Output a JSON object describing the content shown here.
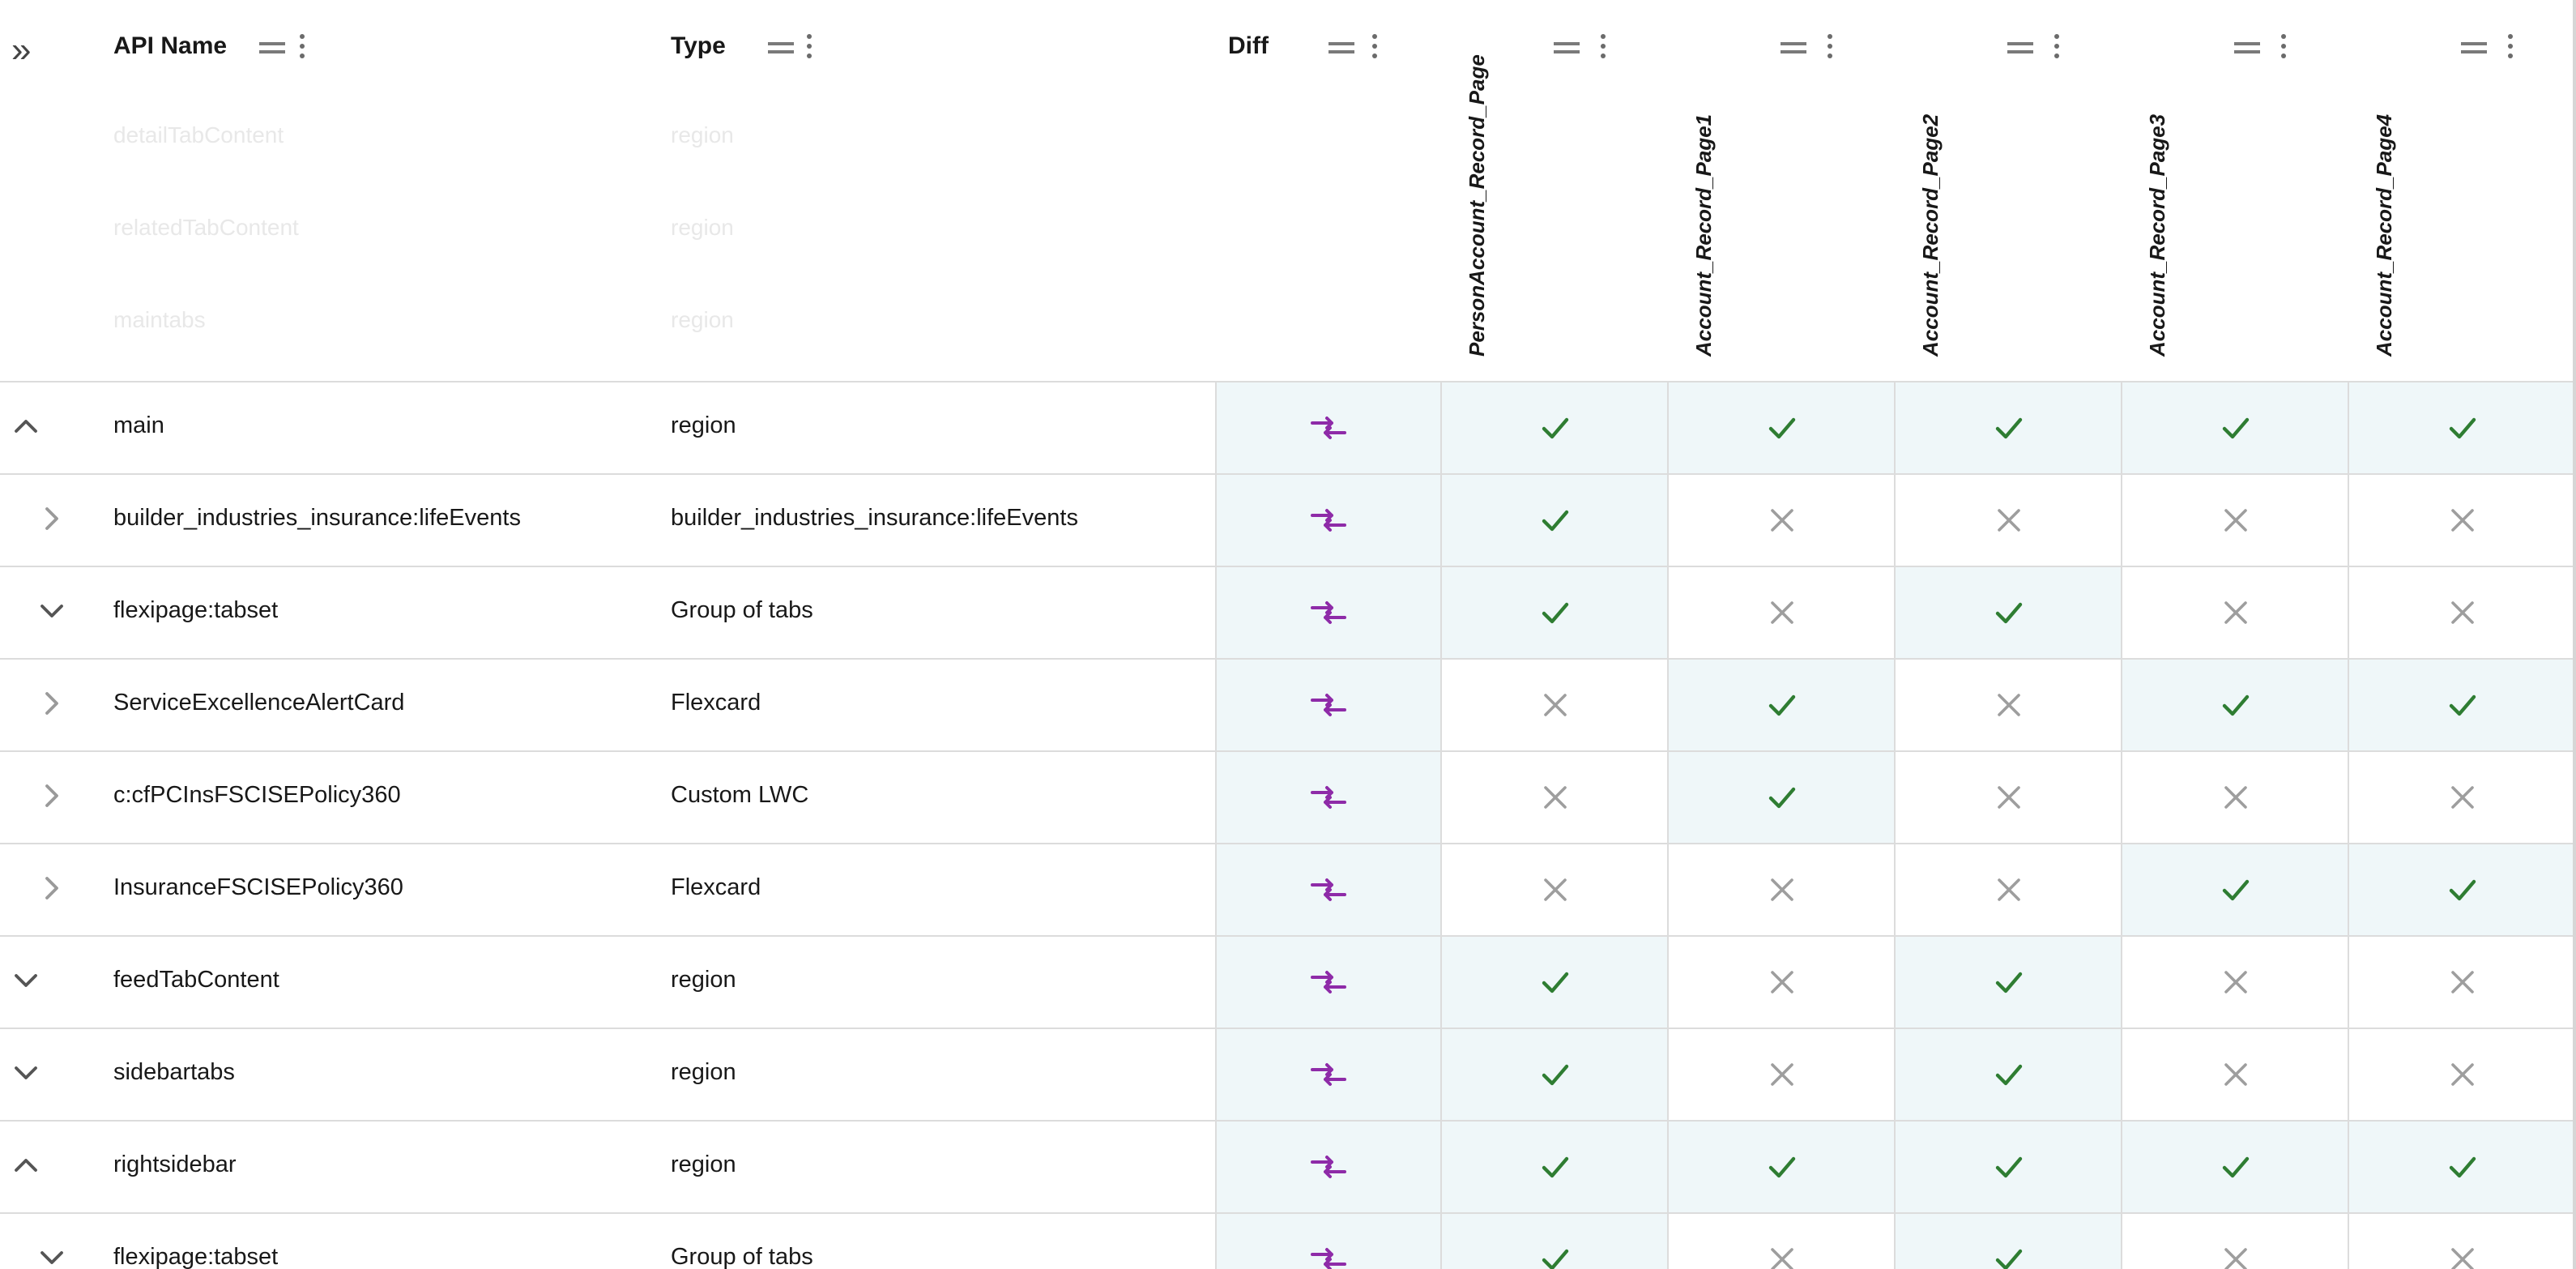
{
  "header": {
    "expand_all_icon": "double-chevron-right-icon",
    "col_api_name": "API Name",
    "col_type": "Type",
    "col_diff": "Diff",
    "page_columns": [
      "PersonAccount_Record_Page",
      "Account_Record_Page1",
      "Account_Record_Page2",
      "Account_Record_Page3",
      "Account_Record_Page4"
    ]
  },
  "ghost_rows": [
    {
      "name": "detailTabContent",
      "type": "region"
    },
    {
      "name": "relatedTabContent",
      "type": "region"
    },
    {
      "name": "maintabs",
      "type": "region"
    }
  ],
  "rows": [
    {
      "chevron": "up",
      "indent": 0,
      "name": "main",
      "type": "region",
      "diff": "diff-icon",
      "pages": [
        true,
        true,
        true,
        true,
        true
      ]
    },
    {
      "chevron": "right",
      "indent": 1,
      "name": "builder_industries_insurance:lifeEvents",
      "type": "builder_industries_insurance:lifeEvents",
      "diff": "diff-icon",
      "pages": [
        true,
        false,
        false,
        false,
        false
      ]
    },
    {
      "chevron": "down",
      "indent": 1,
      "name": "flexipage:tabset",
      "type": "Group of tabs",
      "diff": "diff-icon",
      "pages": [
        true,
        false,
        true,
        false,
        false
      ]
    },
    {
      "chevron": "right",
      "indent": 1,
      "name": "ServiceExcellenceAlertCard",
      "type": "Flexcard",
      "diff": "diff-icon",
      "pages": [
        false,
        true,
        false,
        true,
        true
      ]
    },
    {
      "chevron": "right",
      "indent": 1,
      "name": "c:cfPCInsFSCISEPolicy360",
      "type": "Custom LWC",
      "diff": "diff-icon",
      "pages": [
        false,
        true,
        false,
        false,
        false
      ]
    },
    {
      "chevron": "right",
      "indent": 1,
      "name": "InsuranceFSCISEPolicy360",
      "type": "Flexcard",
      "diff": "diff-icon",
      "pages": [
        false,
        false,
        false,
        true,
        true
      ]
    },
    {
      "chevron": "down",
      "indent": 0,
      "name": "feedTabContent",
      "type": "region",
      "diff": "diff-icon",
      "pages": [
        true,
        false,
        true,
        false,
        false
      ]
    },
    {
      "chevron": "down",
      "indent": 0,
      "name": "sidebartabs",
      "type": "region",
      "diff": "diff-icon",
      "pages": [
        true,
        false,
        true,
        false,
        false
      ]
    },
    {
      "chevron": "up",
      "indent": 0,
      "name": "rightsidebar",
      "type": "region",
      "diff": "diff-icon",
      "pages": [
        true,
        true,
        true,
        true,
        true
      ]
    },
    {
      "chevron": "down",
      "indent": 1,
      "name": "flexipage:tabset",
      "type": "Group of tabs",
      "diff": "diff-icon",
      "pages": [
        true,
        false,
        true,
        false,
        false
      ]
    }
  ],
  "colors": {
    "check": "#2e7d32",
    "cross": "#9e9e9e",
    "diff_icon": "#8e2ba8",
    "shade": "#eff7f9"
  }
}
